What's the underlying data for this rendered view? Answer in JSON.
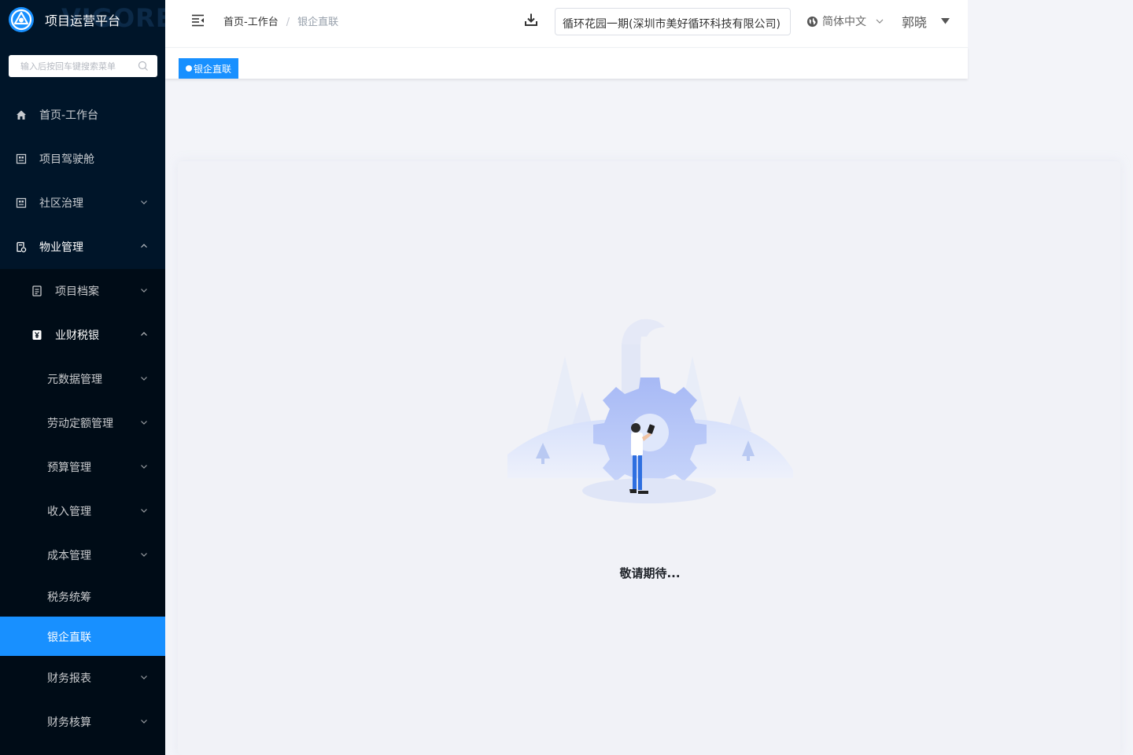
{
  "app": {
    "title": "项目运营平台",
    "watermark": "VIGORE"
  },
  "search": {
    "placeholder": "输入后按回车键搜索菜单"
  },
  "sidebar": {
    "items": [
      {
        "label": "首页-工作台"
      },
      {
        "label": "项目驾驶舱"
      },
      {
        "label": "社区治理"
      },
      {
        "label": "物业管理"
      },
      {
        "label": "项目档案"
      },
      {
        "label": "业财税银"
      },
      {
        "label": "元数据管理"
      },
      {
        "label": "劳动定额管理"
      },
      {
        "label": "预算管理"
      },
      {
        "label": "收入管理"
      },
      {
        "label": "成本管理"
      },
      {
        "label": "税务统筹"
      },
      {
        "label": "银企直联"
      },
      {
        "label": "财务报表"
      },
      {
        "label": "财务核算"
      }
    ]
  },
  "header": {
    "breadcrumb": {
      "home": "首页-工作台",
      "separator": "/",
      "current": "银企直联"
    },
    "project": "循环花园一期(深圳市美好循环科技有限公司)",
    "language": "简体中文",
    "user": "郭晓"
  },
  "tabs": [
    {
      "label": "银企直联"
    }
  ],
  "content": {
    "message": "敬请期待..."
  },
  "colors": {
    "accent": "#1890ff",
    "sidebar": "#001529",
    "sidebar_sub": "#000c17"
  }
}
